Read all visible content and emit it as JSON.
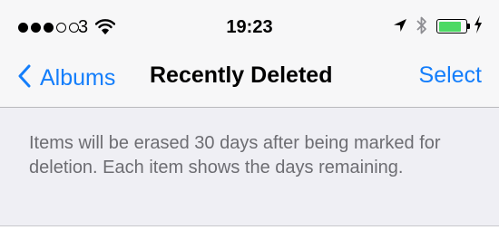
{
  "status_bar": {
    "signal_bars_filled": 3,
    "signal_bars_total": 5,
    "carrier": "3",
    "time": "19:23",
    "battery_level": 0.85,
    "icons": [
      "wifi-icon",
      "location-arrow-icon",
      "bluetooth-icon",
      "battery-icon",
      "charging-bolt-icon"
    ],
    "battery_color": "#4cd964"
  },
  "nav": {
    "back_label": "Albums",
    "title": "Recently Deleted",
    "action_label": "Select",
    "tint_color": "#147efb"
  },
  "info": {
    "message": "Items will be erased 30 days after being marked for deletion. Each item shows the days remaining."
  }
}
